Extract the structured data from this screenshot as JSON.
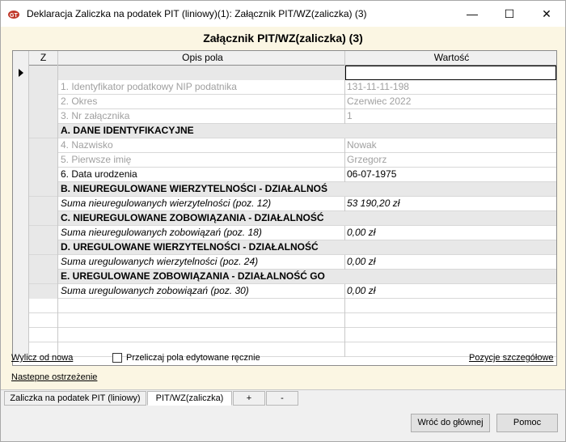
{
  "window": {
    "title": "Deklaracja Zaliczka na podatek PIT (liniowy)(1): Załącznik PIT/WZ(zaliczka) (3)",
    "controls": {
      "minimize": "—",
      "maximize": "☐",
      "close": "✕"
    }
  },
  "heading": "Załącznik PIT/WZ(zaliczka) (3)",
  "grid": {
    "columns": {
      "z": "Z",
      "opis": "Opis pola",
      "value": "Wartość"
    },
    "rows": [
      {
        "label": "",
        "value": ""
      },
      {
        "label": "1. Identyfikator podatkowy NIP podatnika",
        "value": "131-11-11-198"
      },
      {
        "label": "2. Okres",
        "value": "Czerwiec 2022"
      },
      {
        "label": "3. Nr załącznika",
        "value": "1"
      },
      {
        "label": "A. DANE IDENTYFIKACYJNE",
        "value": ""
      },
      {
        "label": "4. Nazwisko",
        "value": "Nowak"
      },
      {
        "label": "5. Pierwsze imię",
        "value": "Grzegorz"
      },
      {
        "label": "6. Data urodzenia",
        "value": "06-07-1975"
      },
      {
        "label": "B. NIEUREGULOWANE WIERZYTELNOŚCI - DZIAŁALNOŚ",
        "value": ""
      },
      {
        "label": "Suma nieuregulowanych wierzytelności (poz. 12)",
        "value": "53 190,20 zł"
      },
      {
        "label": "C. NIEUREGULOWANE ZOBOWIĄZANIA - DZIAŁALNOŚĆ",
        "value": ""
      },
      {
        "label": "Suma nieuregulowanych zobowiązań (poz. 18)",
        "value": "0,00 zł"
      },
      {
        "label": "D. UREGULOWANE WIERZYTELNOŚCI - DZIAŁALNOŚĆ",
        "value": ""
      },
      {
        "label": "Suma uregulowanych wierzytelności (poz. 24)",
        "value": "0,00 zł"
      },
      {
        "label": "E. UREGULOWANE ZOBOWIĄZANIA - DZIAŁALNOŚĆ GO",
        "value": ""
      },
      {
        "label": "Suma uregulowanych zobowiązań (poz. 30)",
        "value": "0,00 zł"
      }
    ]
  },
  "links": {
    "recalc": "Wylicz od nowa",
    "checkbox_label": "Przeliczaj pola edytowane ręcznie",
    "details": "Pozycje szczegółowe",
    "next_warning": "Nastepne ostrzeżenie"
  },
  "tabs": [
    "Zaliczka na podatek PIT (liniowy)",
    "PIT/WZ(zaliczka)",
    "+",
    "-"
  ],
  "buttons": {
    "back": "Wróć do głównej",
    "help": "Pomoc"
  },
  "colors": {
    "background": "#fbf6e3",
    "section_row": "#e8e8e8",
    "disabled_text": "#a0a0a0"
  }
}
